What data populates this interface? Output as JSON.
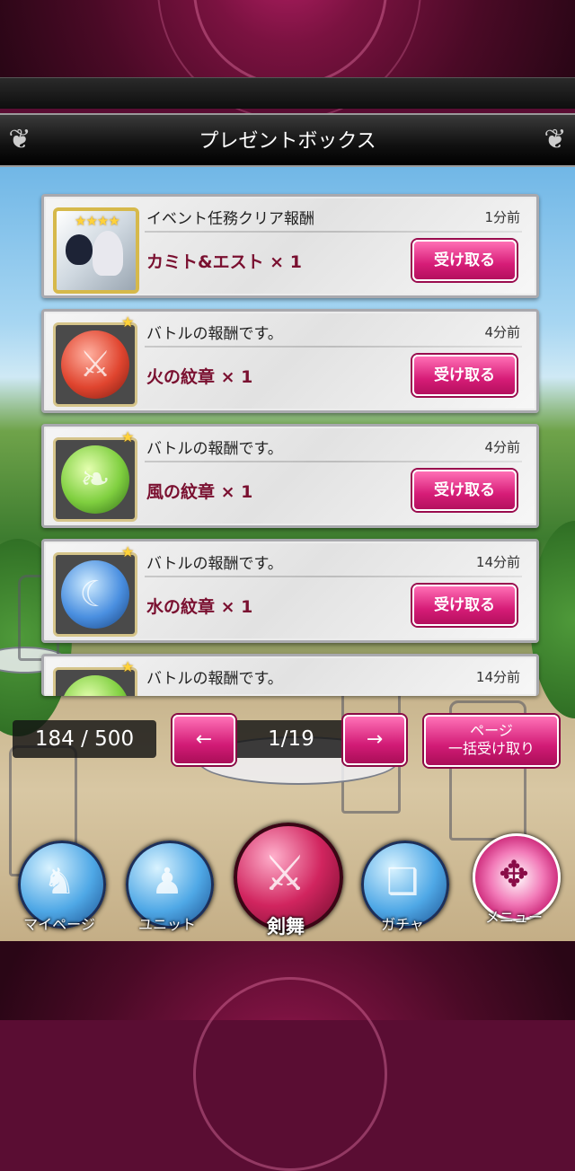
{
  "header": {
    "title": "プレゼントボックス"
  },
  "items": [
    {
      "message": "イベント任務クリア報酬",
      "time": "1分前",
      "reward": "カミト&エスト × 1",
      "button": "受け取る",
      "stars": "★★★★",
      "icon": "character-portrait"
    },
    {
      "message": "バトルの報酬です。",
      "time": "4分前",
      "reward": "火の紋章 × 1",
      "button": "受け取る",
      "stars": "★",
      "icon": "fire-emblem"
    },
    {
      "message": "バトルの報酬です。",
      "time": "4分前",
      "reward": "風の紋章 × 1",
      "button": "受け取る",
      "stars": "★",
      "icon": "wind-emblem"
    },
    {
      "message": "バトルの報酬です。",
      "time": "14分前",
      "reward": "水の紋章 × 1",
      "button": "受け取る",
      "stars": "★",
      "icon": "water-emblem"
    },
    {
      "message": "バトルの報酬です。",
      "time": "14分前",
      "stars": "★",
      "icon": "wind-emblem"
    }
  ],
  "pager": {
    "count": "184 / 500",
    "prev": "←",
    "page": "1/19",
    "next": "→",
    "bulk_line1": "ページ",
    "bulk_line2": "一括受け取り"
  },
  "nav": [
    {
      "label": "マイページ",
      "icon": "mypage-icon"
    },
    {
      "label": "ユニット",
      "icon": "unit-icon"
    },
    {
      "label": "剣舞",
      "icon": "sword-dance-icon"
    },
    {
      "label": "ガチャ",
      "icon": "gacha-icon"
    },
    {
      "label": "メニュー",
      "icon": "menu-icon"
    }
  ],
  "colors": {
    "accent": "#d61c77",
    "frame": "#7a1240",
    "reward_text": "#7a1030"
  }
}
